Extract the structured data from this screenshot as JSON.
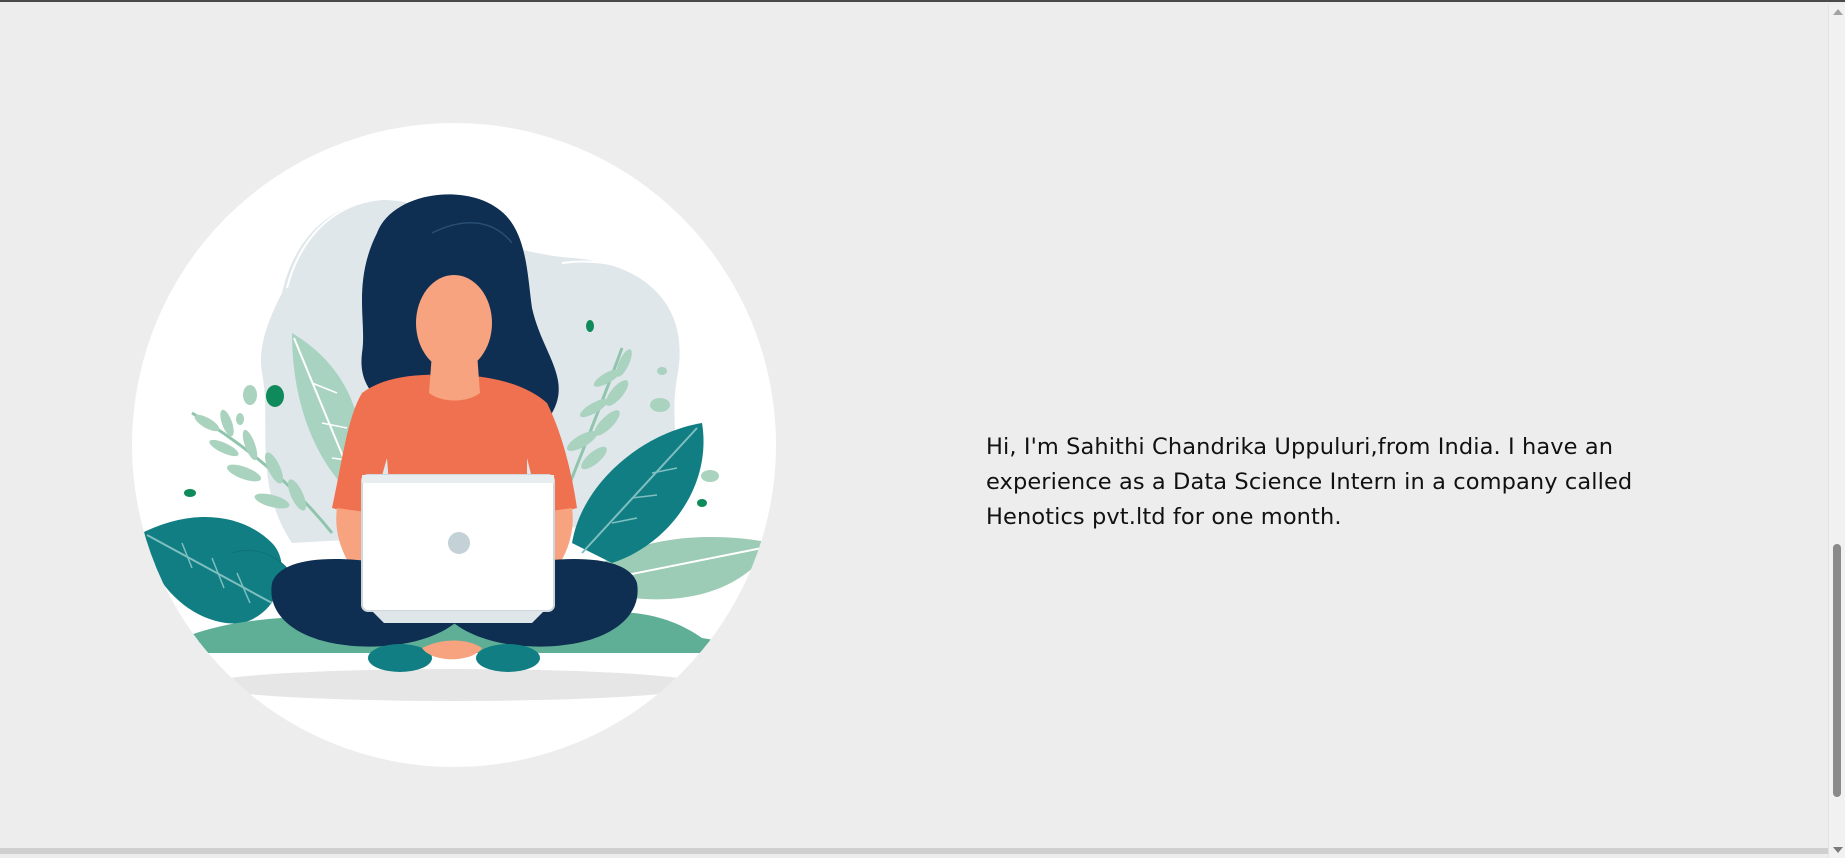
{
  "about": {
    "bio_line_1": "Hi, I'm Sahithi Chandrika Uppuluri,from India. I have an",
    "bio_line_2": "experience as a Data Science Intern in a company called",
    "bio_line_3": "Henotics pvt.ltd for one month."
  },
  "illustration": {
    "icon": "woman-with-laptop-illustration",
    "colors": {
      "page_bg": "#ededed",
      "circle_bg": "#ffffff",
      "hair_navy": "#0e2e52",
      "shirt_coral": "#f0714f",
      "skin": "#f7a37f",
      "teal_leaf": "#107e83",
      "mint_leaf": "#9ccbb6",
      "laptop": "#ffffff",
      "backdrop_blob": "#dfe7eb"
    }
  }
}
